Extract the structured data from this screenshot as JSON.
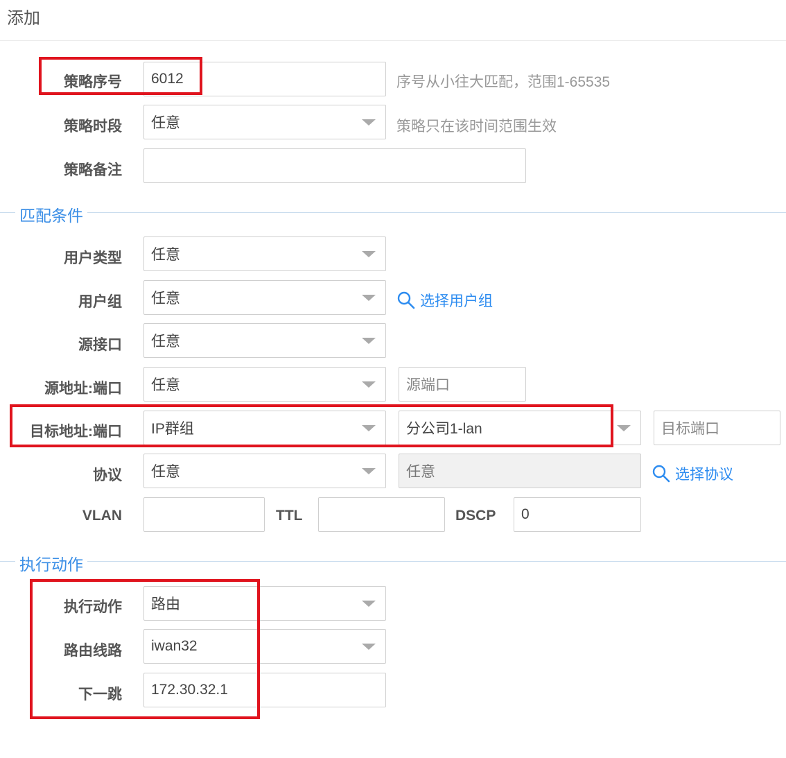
{
  "header": {
    "title": "添加"
  },
  "policy": {
    "seq": {
      "label": "策略序号",
      "value": "6012",
      "hint": "序号从小往大匹配，范围1-65535"
    },
    "period": {
      "label": "策略时段",
      "value": "任意",
      "hint": "策略只在该时间范围生效"
    },
    "remark": {
      "label": "策略备注",
      "value": ""
    }
  },
  "match": {
    "section_title": "匹配条件",
    "user_type": {
      "label": "用户类型",
      "value": "任意"
    },
    "user_group": {
      "label": "用户组",
      "value": "任意",
      "link": "选择用户组"
    },
    "src_iface": {
      "label": "源接口",
      "value": "任意"
    },
    "src_addr": {
      "label": "源地址:端口",
      "value": "任意",
      "port_placeholder": "源端口"
    },
    "dst_addr": {
      "label": "目标地址:端口",
      "type_value": "IP群组",
      "group_value": "分公司1-lan",
      "port_placeholder": "目标端口"
    },
    "protocol": {
      "label": "协议",
      "value": "任意",
      "detail": "任意",
      "link": "选择协议"
    },
    "vlan": {
      "label": "VLAN",
      "value": ""
    },
    "ttl": {
      "label": "TTL",
      "value": ""
    },
    "dscp": {
      "label": "DSCP",
      "value": "0"
    }
  },
  "action": {
    "section_title": "执行动作",
    "exec": {
      "label": "执行动作",
      "value": "路由"
    },
    "route_line": {
      "label": "路由线路",
      "value": "iwan32"
    },
    "next_hop": {
      "label": "下一跳",
      "value": "172.30.32.1"
    }
  },
  "colors": {
    "accent": "#2d8cf0",
    "highlight": "#e0141e",
    "section_line": "#c9dcee"
  },
  "icons": {
    "search": "magnifier-icon",
    "dropdown": "caret-down-icon"
  }
}
